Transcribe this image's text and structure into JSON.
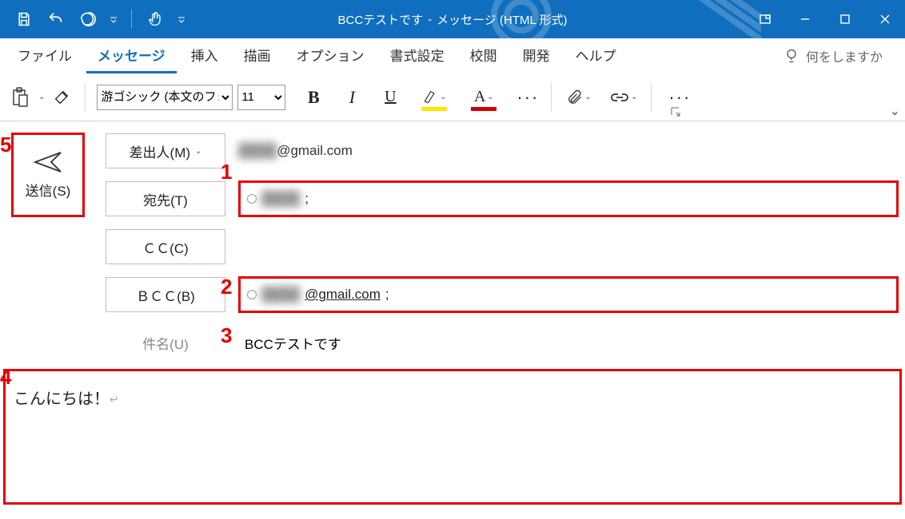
{
  "window": {
    "title_doc": "BCCテストです",
    "title_sep": "-",
    "title_kind": "メッセージ (HTML 形式)"
  },
  "ribbon": {
    "tabs": [
      "ファイル",
      "メッセージ",
      "挿入",
      "描画",
      "オプション",
      "書式設定",
      "校閲",
      "開発",
      "ヘルプ"
    ],
    "active_tab_index": 1,
    "tell_me_placeholder": "何をしますか"
  },
  "toolbar": {
    "font_name": "游ゴシック (本文のフォント)",
    "font_size": "11",
    "bold_glyph": "B",
    "italic_glyph": "I",
    "underline_glyph": "U",
    "highlight_glyph": "🖉",
    "fontcolor_glyph": "A",
    "ellipsis": "···"
  },
  "compose": {
    "send_label": "送信(S)",
    "from_button": "差出人(M)",
    "from_value_blur": "████",
    "from_value_suffix": "@gmail.com",
    "to_button": "宛先(T)",
    "to_value_blur": "████",
    "to_trailing": ";",
    "cc_button": "ＣＣ(C)",
    "bcc_button": "ＢＣＣ(B)",
    "bcc_value_blur": "████",
    "bcc_value_suffix": "@gmail.com",
    "bcc_trailing": ";",
    "subject_label": "件名(U)",
    "subject_value": "BCCテストです"
  },
  "body": {
    "text": "こんにちは！",
    "pilcrow": "↵"
  },
  "annotations": {
    "n1": "1",
    "n2": "2",
    "n3": "3",
    "n4": "4",
    "n5": "5"
  }
}
